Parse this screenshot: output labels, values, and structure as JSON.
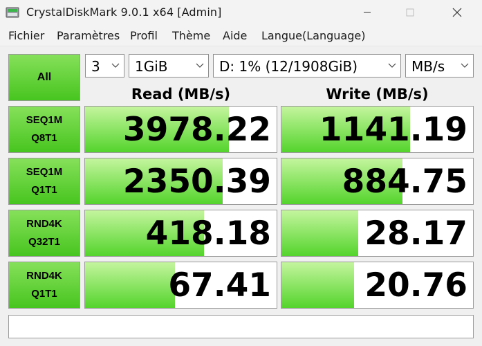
{
  "window": {
    "title": "CrystalDiskMark 9.0.1 x64 [Admin]"
  },
  "menu": [
    "Fichier",
    "Paramètres",
    "Profil",
    "Thème",
    "Aide",
    "Langue(Language)"
  ],
  "controls": {
    "all_label": "All",
    "count": "3",
    "size": "1GiB",
    "drive": "D: 1% (12/1908GiB)",
    "unit": "MB/s"
  },
  "headers": {
    "read": "Read (MB/s)",
    "write": "Write (MB/s)"
  },
  "tests": [
    {
      "line1": "SEQ1M",
      "line2": "Q8T1",
      "read": "3978.22",
      "write": "1141.19",
      "read_fill": 0.75,
      "write_fill": 0.67
    },
    {
      "line1": "SEQ1M",
      "line2": "Q1T1",
      "read": "2350.39",
      "write": "884.75",
      "read_fill": 0.72,
      "write_fill": 0.63
    },
    {
      "line1": "RND4K",
      "line2": "Q32T1",
      "read": "418.18",
      "write": "28.17",
      "read_fill": 0.62,
      "write_fill": 0.4
    },
    {
      "line1": "RND4K",
      "line2": "Q1T1",
      "read": "67.41",
      "write": "20.76",
      "read_fill": 0.47,
      "write_fill": 0.38
    }
  ],
  "status": "",
  "colors": {
    "accent": "#47c51f",
    "bar_light": "#c4f59e",
    "bar_dark": "#54d42c"
  },
  "icons": [
    "app-icon",
    "minimize-icon",
    "maximize-icon",
    "close-icon",
    "chevron-down-icon"
  ]
}
